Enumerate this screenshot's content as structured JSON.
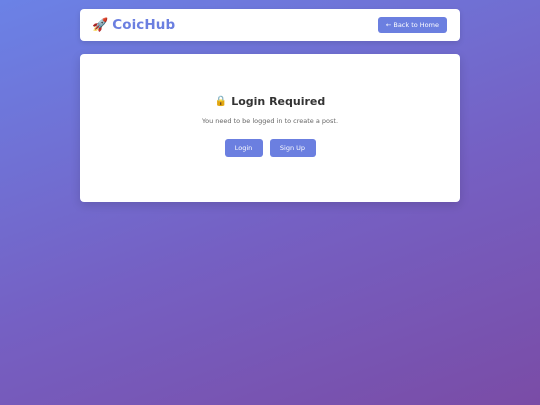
{
  "header": {
    "brand_icon": "🚀",
    "brand_name": "CoicHub",
    "back_label": "← Back to Home"
  },
  "auth_card": {
    "lock_icon": "🔒",
    "title": "Login Required",
    "message": "You need to be logged in to create a post.",
    "login_label": "Login",
    "signup_label": "Sign Up"
  },
  "colors": {
    "accent": "#6b7fe0",
    "background_start": "#6b82e6",
    "background_end": "#7a4ca6"
  }
}
